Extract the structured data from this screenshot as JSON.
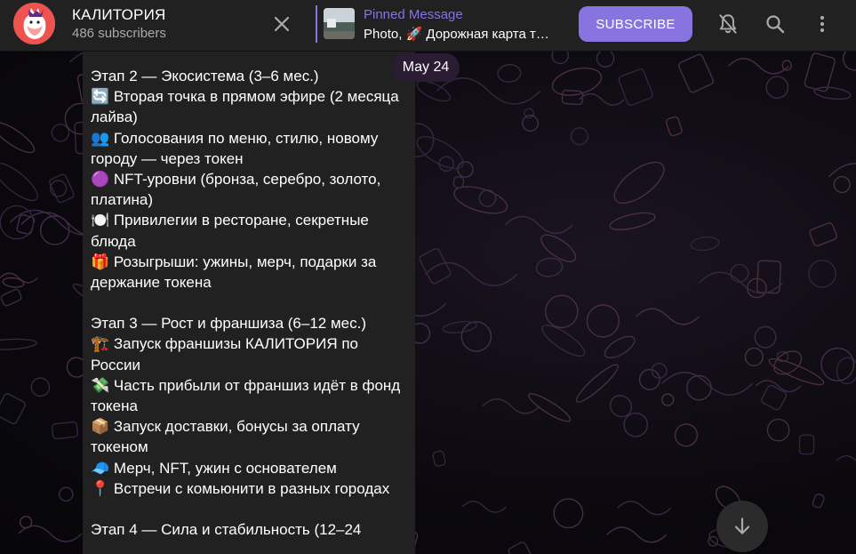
{
  "header": {
    "channel_title": "КАЛИТОРИЯ",
    "subscribers": "486 subscribers",
    "pinned_label": "Pinned Message",
    "pinned_text": "Photo, 🚀 Дорожная карта т…",
    "subscribe_label": "SUBSCRIBE",
    "icons": [
      "close-icon",
      "bell-muted-icon",
      "search-icon",
      "more-vertical-icon"
    ]
  },
  "date_pill": "May 24",
  "message": {
    "lines": [
      "Этап 2 — Экосистема (3–6 мес.)",
      "🔄  Вторая точка в прямом эфире (2 месяца лайва)",
      "👥  Голосования по меню, стилю, новому городу — через токен",
      "🟣 NFT-уровни (бронза, серебро, золото, платина)",
      "🍽️  Привилегии в ресторане, секретные блюда",
      "🎁  Розыгрыши: ужины, мерч, подарки за держание токена",
      "",
      "Этап 3 — Рост и франшиза (6–12 мес.)",
      "🏗️  Запуск франшизы КАЛИТОРИЯ по России",
      "💸  Часть прибыли от франшиз идёт в фонд токена",
      "📦  Запуск доставки, бонусы за оплату токеном",
      "🧢  Мерч, NFT, ужин с основателем",
      "📍  Встречи с комьюнити в разных городах",
      "",
      "Этап 4 — Сила и стабильность (12–24"
    ]
  },
  "colors": {
    "accent": "#8774e1",
    "header_bg": "#212121",
    "bubble_bg": "#212121",
    "avatar_bg": "#ef5350"
  }
}
